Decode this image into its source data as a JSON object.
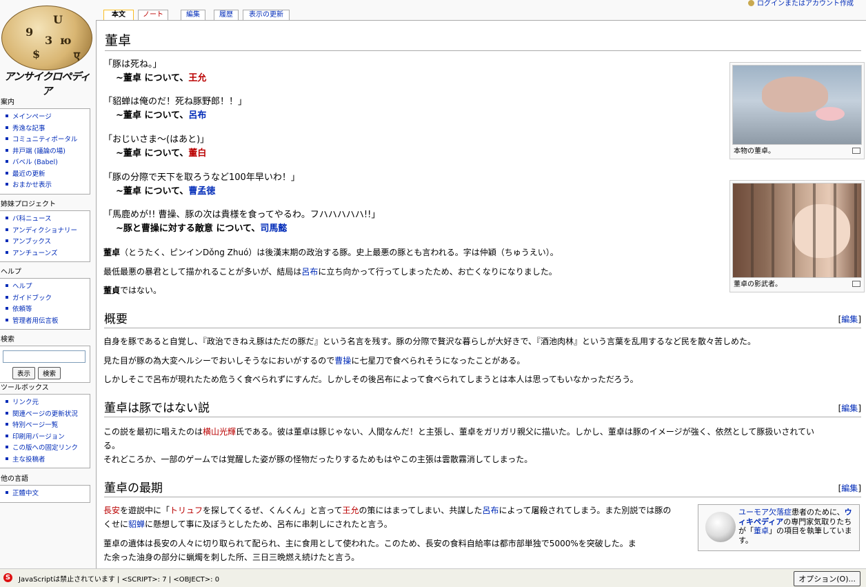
{
  "user_bar": {
    "login": "ログインまたはアカウント作成"
  },
  "logo": {
    "title": "アンサイクロペディア",
    "glyphs": [
      "U",
      "9",
      "ю",
      "$",
      "3",
      "ए"
    ]
  },
  "sidebar": {
    "navigation": {
      "title": "案内",
      "items": [
        "メインページ",
        "秀逸な記事",
        "コミュニティポータル",
        "井戸端 (議論の場)",
        "バベル (Babel)",
        "最近の更新",
        "おまかせ表示"
      ]
    },
    "sister": {
      "title": "姉妹プロジェクト",
      "items": [
        "バ科ニュース",
        "アンディクショナリー",
        "アンブックス",
        "アンチューンズ"
      ]
    },
    "help": {
      "title": "ヘルプ",
      "items": [
        "ヘルプ",
        "ガイドブック",
        "依頼等",
        "管理者用伝言板"
      ]
    },
    "search": {
      "title": "検索",
      "go": "表示",
      "search": "検索"
    },
    "toolbox": {
      "title": "ツールボックス",
      "items": [
        "リンク元",
        "関連ページの更新状況",
        "特別ページ一覧",
        "印刷用バージョン",
        "この版への固定リンク",
        "主な投稿者"
      ]
    },
    "languages": {
      "title": "他の言語",
      "items": [
        "正體中文"
      ]
    }
  },
  "tabs": [
    "本文",
    "ノート",
    "編集",
    "履歴",
    "表示の更新"
  ],
  "article": {
    "title": "董卓",
    "quotes": [
      {
        "text": "「豚は死ね。」",
        "prefix": "~",
        "subject": "董卓",
        "mid": " について、",
        "who": "王允",
        "who_color": "red"
      },
      {
        "text": "「貂蝉は俺のだ！死ね豚野郎！！」",
        "prefix": "~",
        "subject": "董卓",
        "mid": " について、",
        "who": "呂布",
        "who_color": "blue"
      },
      {
        "text": "「おじいさま〜(はあと)」",
        "prefix": "~",
        "subject": "董卓",
        "mid": " について、",
        "who": "董白",
        "who_color": "red"
      },
      {
        "text": "「豚の分際で天下を取ろうなど100年早いわ！」",
        "prefix": "~",
        "subject": "董卓",
        "mid": " について、",
        "who": "曹孟徳",
        "who_color": "blue"
      },
      {
        "text": "「馬鹿めが!! 曹操、豚の次は貴様を食ってやるわ。フハハハハハ!!」",
        "prefix": "~",
        "subject": "豚と曹操に対する敵意",
        "mid": " について、",
        "who": "司馬懿",
        "who_color": "blue"
      }
    ],
    "intro": {
      "p1_bold": "董卓",
      "p1_rest": "（とうたく、ピンインDǒng Zhuó）は後漢末期の政治する豚。史上最悪の豚とも言われる。字は仲穎（ちゅうえい）。",
      "p2_a": "最低最悪の暴君として描かれることが多いが、結局は",
      "p2_link": "呂布",
      "p2_b": "に立ち向かって行ってしまったため、お亡くなりになりました。",
      "p3_bold": "董貞",
      "p3_rest": "ではない。"
    },
    "edit_label": "編集",
    "sections": [
      {
        "title": "概要",
        "p1": "自身を豚であると自覚し、『政治できねえ豚はただの豚だ』という名言を残す。豚の分際で贅沢な暮らしが大好きで、『酒池肉林』という言葉を乱用するなど民を散々苦しめた。",
        "p2_a": "見た目が豚の為大変ヘルシーでおいしそうなにおいがするので",
        "p2_link": "曹操",
        "p2_b": "に七星刀で食べられそうになったことがある。",
        "p3": "しかしそこで呂布が現れたため危うく食べられずにすんだ。しかしその後呂布によって食べられてしまうとは本人は思ってもいなかっただろう。"
      },
      {
        "title": "董卓は豚ではない説",
        "p1_a": "この説を最初に唱えたのは",
        "p1_link": "横山光輝",
        "p1_b": "氏である。彼は董卓は豚じゃない、人間なんだ！と主張し、董卓をガリガリ親父に描いた。しかし、董卓は豚のイメージが強く、依然として豚扱いされてい",
        "p1_c": "る。",
        "p2": "それどころか、一部のゲームでは覚醒した姿が豚の怪物だったりするためもはやこの主張は雲散霧消してしまった。"
      },
      {
        "title": "董卓の最期",
        "p1_l1": "長安",
        "p1_t1": "を遊説中に「",
        "p1_l2": "トリュフ",
        "p1_t2": "を探してくるぜ、くんくん」と言って",
        "p1_l3": "王允",
        "p1_t3": "の策にはまってしまい、共謀した",
        "p1_l4": "呂布",
        "p1_t4": "によって屠殺されてしまう。また別説では豚の",
        "p1_t5": "くせに",
        "p1_l5": "貂蝉",
        "p1_t6": "に懸想して事に及ぼうとしたため、呂布に串刺しにされたと言う。",
        "p2_l1": "董卓の遺体は長安の人々に切り取られて配られ、主に食用として使われた。このため、長安の食料自給率は都市部単独で5000%を突破した。ま",
        "p2_l2": "た余った油身の部分に蝋燭を刺した所、三日三晩燃え続けたと言う。"
      }
    ],
    "thumbs": [
      {
        "caption": "本物の董卓。"
      },
      {
        "caption": "董卓の影武者。"
      }
    ],
    "notice": {
      "link1": "ユーモア欠落症",
      "t1": "患者のために、",
      "link2": "ウィキペディア",
      "t2": "の専門家気取りたちが「",
      "link3": "董卓",
      "t3": "」の項目を執筆しています。"
    }
  },
  "statusbar": {
    "text": "JavaScriptは禁止されています | <SCRIPT>: 7 | <OBJECT>: 0",
    "options": "オプション(O)..."
  }
}
